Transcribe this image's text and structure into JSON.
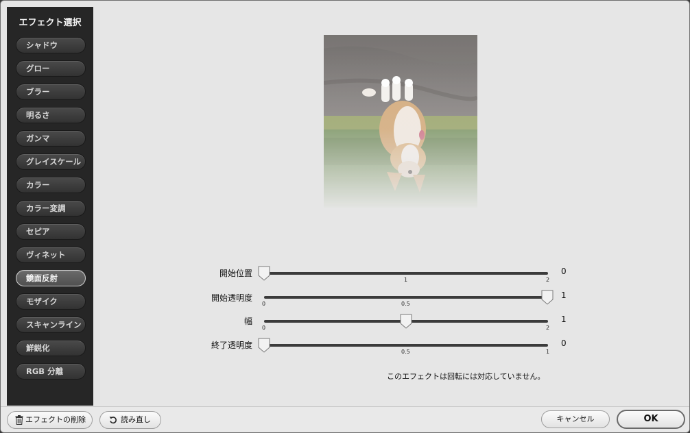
{
  "sidebar": {
    "title": "エフェクト選択",
    "items": [
      {
        "label": "シャドウ"
      },
      {
        "label": "グロー"
      },
      {
        "label": "ブラー"
      },
      {
        "label": "明るさ"
      },
      {
        "label": "ガンマ"
      },
      {
        "label": "グレイスケール"
      },
      {
        "label": "カラー"
      },
      {
        "label": "カラー変調"
      },
      {
        "label": "セピア"
      },
      {
        "label": "ヴィネット"
      },
      {
        "label": "鏡面反射",
        "selected": true
      },
      {
        "label": "モザイク"
      },
      {
        "label": "スキャンライン"
      },
      {
        "label": "鮮鋭化"
      },
      {
        "label": "RGB 分離"
      }
    ]
  },
  "sliders": [
    {
      "label": "開始位置",
      "value": "0",
      "ticks": [
        "1",
        "2"
      ]
    },
    {
      "label": "開始透明度",
      "value": "1",
      "ticks": [
        "0",
        "0.5"
      ]
    },
    {
      "label": "幅",
      "value": "1",
      "ticks": [
        "0",
        "2"
      ]
    },
    {
      "label": "終了透明度",
      "value": "0",
      "ticks": [
        "0.5",
        "1"
      ]
    }
  ],
  "note": "このエフェクトは回転には対応していません。",
  "footer": {
    "delete_label": "エフェクトの削除",
    "reload_label": "読み直し",
    "cancel_label": "キャンセル",
    "ok_label": "OK"
  },
  "colors": {
    "sidebar_bg": "#262626",
    "window_bg": "#e6e6e6"
  }
}
